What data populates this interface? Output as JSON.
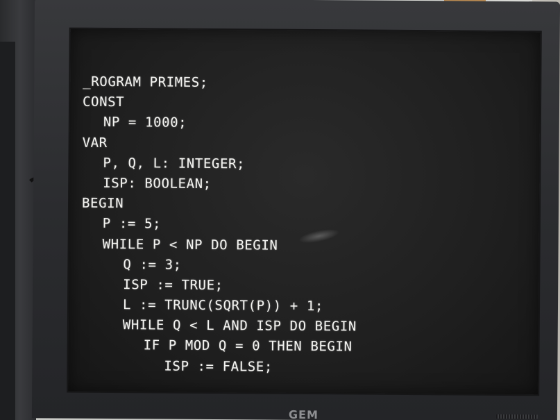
{
  "screen": {
    "code_lines": [
      {
        "indent": 0,
        "text": "_ROGRAM PRIMES;"
      },
      {
        "indent": 0,
        "text": "CONST"
      },
      {
        "indent": 1,
        "text": "NP = 1000;"
      },
      {
        "indent": 0,
        "text": "VAR"
      },
      {
        "indent": 1,
        "text": "P, Q, L: INTEGER;"
      },
      {
        "indent": 1,
        "text": "ISP: BOOLEAN;"
      },
      {
        "indent": 0,
        "text": "BEGIN"
      },
      {
        "indent": 1,
        "text": "P := 5;"
      },
      {
        "indent": 1,
        "text": "WHILE P < NP DO BEGIN"
      },
      {
        "indent": 2,
        "text": "Q := 3;"
      },
      {
        "indent": 2,
        "text": "ISP := TRUE;"
      },
      {
        "indent": 2,
        "text": "L := TRUNC(SQRT(P)) + 1;"
      },
      {
        "indent": 2,
        "text": "WHILE Q < L AND ISP DO BEGIN"
      },
      {
        "indent": 3,
        "text": "IF P MOD Q = 0 THEN BEGIN"
      },
      {
        "indent": 4,
        "text": "ISP := FALSE;"
      }
    ]
  },
  "monitor": {
    "brand": "GEM"
  },
  "colors": {
    "screen_background": "#1f1f1f",
    "text": "#f4f4f1",
    "bezel": "#2b2c2f"
  }
}
